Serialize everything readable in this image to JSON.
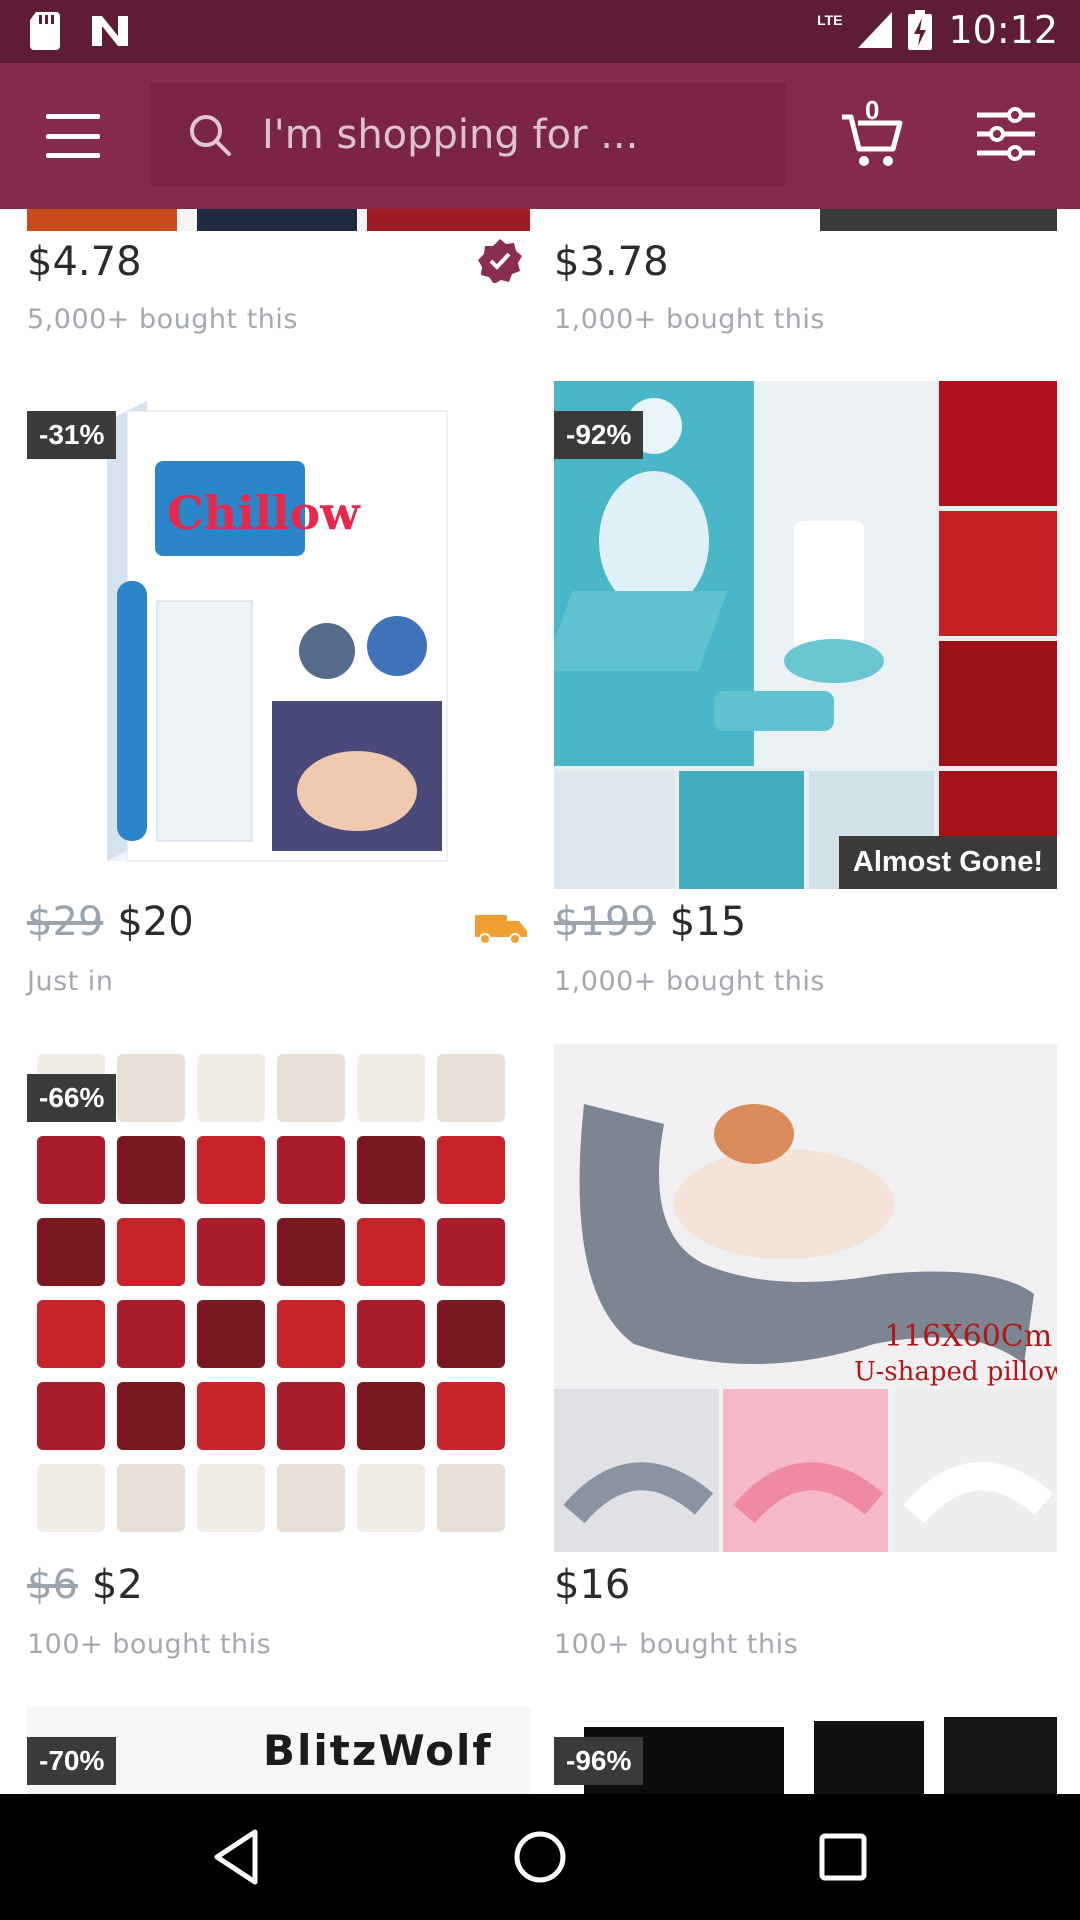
{
  "status_bar": {
    "network": "LTE",
    "time": "10:12"
  },
  "header": {
    "search_placeholder": "I'm shopping for ...",
    "cart_count": "0"
  },
  "products": [
    {
      "id": "p1",
      "old_price": "",
      "price": "$4.78",
      "subtitle": "5,000+ bought this",
      "badge": "",
      "tag": "",
      "indicator": "verified-check-icon"
    },
    {
      "id": "p2",
      "old_price": "",
      "price": "$3.78",
      "subtitle": "1,000+ bought this",
      "badge": "",
      "tag": ""
    },
    {
      "id": "p3",
      "old_price": "$29",
      "price": "$20",
      "subtitle": "Just in",
      "badge": "-31%",
      "tag": "",
      "indicator": "truck-icon",
      "image_text": "Chillow"
    },
    {
      "id": "p4",
      "old_price": "$199",
      "price": "$15",
      "subtitle": "1,000+ bought this",
      "badge": "-92%",
      "tag": "Almost Gone!"
    },
    {
      "id": "p5",
      "old_price": "$6",
      "price": "$2",
      "subtitle": "100+ bought this",
      "badge": "-66%",
      "tag": ""
    },
    {
      "id": "p6",
      "old_price": "",
      "price": "$16",
      "subtitle": "100+ bought this",
      "badge": "",
      "tag": "",
      "image_text": [
        "116X60Cm",
        "U-shaped pillow"
      ]
    },
    {
      "id": "p7",
      "badge": "-70%",
      "image_text": "BlitzWolf"
    },
    {
      "id": "p8",
      "badge": "-96%"
    }
  ],
  "colors": {
    "status_bar": "#5e1c37",
    "header": "#842a4e",
    "accent": "#8a2d53"
  }
}
